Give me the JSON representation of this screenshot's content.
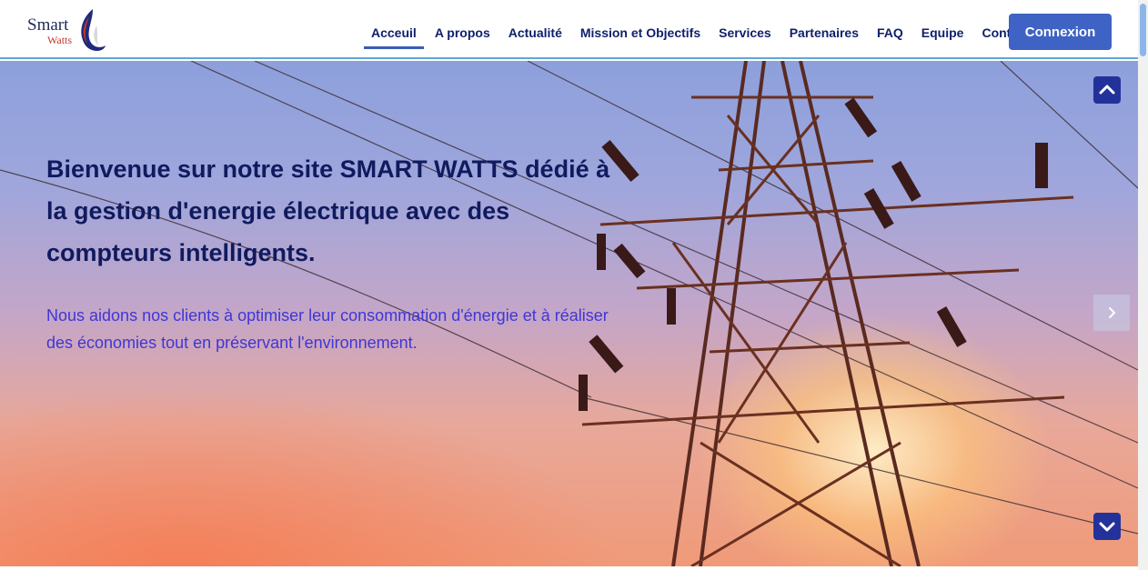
{
  "logo": {
    "name_top": "Smart",
    "name_bottom": "Watts"
  },
  "nav": {
    "items": [
      {
        "label": "Acceuil",
        "active": true
      },
      {
        "label": "A propos"
      },
      {
        "label": "Actualité"
      },
      {
        "label": "Mission et Objectifs"
      },
      {
        "label": "Services"
      },
      {
        "label": "Partenaires"
      },
      {
        "label": "FAQ"
      },
      {
        "label": "Equipe"
      },
      {
        "label": "Contact"
      }
    ],
    "login_label": "Connexion"
  },
  "hero": {
    "title": "Bienvenue sur notre site SMART WATTS dédié à la gestion d'energie électrique avec des compteurs intelligents.",
    "subtitle": "Nous aidons nos clients à optimiser leur consommation d'énergie et à réaliser des économies tout en préservant l'environnement."
  },
  "icons": {
    "scroll_up": "chevron-up-icon",
    "scroll_down": "chevron-down-icon",
    "next": "chevron-right-icon"
  },
  "colors": {
    "nav_text": "#0f1f6b",
    "accent": "#3f63c4",
    "hero_title": "#101a5e",
    "hero_subtitle": "#3f36d6"
  }
}
